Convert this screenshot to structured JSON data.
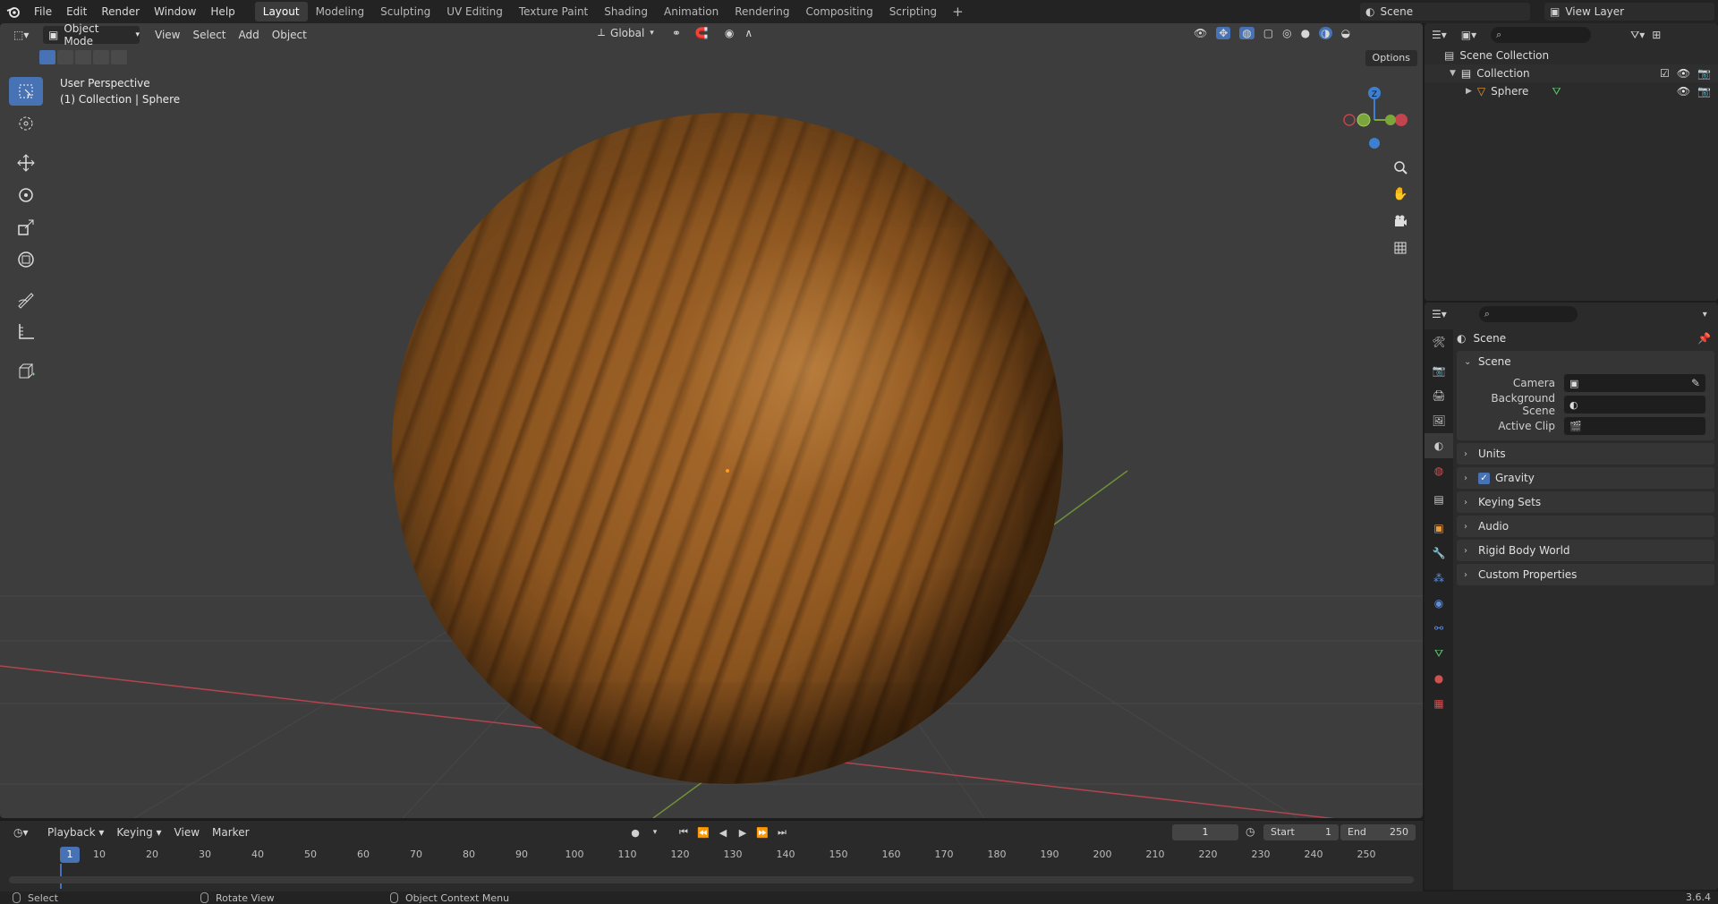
{
  "topbar": {
    "menus": [
      "File",
      "Edit",
      "Render",
      "Window",
      "Help"
    ],
    "workspaces": [
      "Layout",
      "Modeling",
      "Sculpting",
      "UV Editing",
      "Texture Paint",
      "Shading",
      "Animation",
      "Rendering",
      "Compositing",
      "Scripting"
    ],
    "active_workspace": "Layout",
    "add_label": "+",
    "scene": "Scene",
    "view_layer": "View Layer"
  },
  "viewport": {
    "mode": "Object Mode",
    "menus": [
      "View",
      "Select",
      "Add",
      "Object"
    ],
    "orientation": "Global",
    "options_label": "Options",
    "overlay_line1": "User Perspective",
    "overlay_line2": "(1) Collection | Sphere",
    "gizmo": {
      "z": "Z"
    },
    "tools": [
      "select-box-icon",
      "cursor-icon",
      "move-icon",
      "rotate-icon",
      "scale-icon",
      "transform-icon",
      "annotate-icon",
      "measure-icon",
      "add-cube-icon"
    ]
  },
  "timeline": {
    "menus": [
      "Playback",
      "Keying",
      "View",
      "Marker"
    ],
    "current_frame": "1",
    "start_label": "Start",
    "start_value": "1",
    "end_label": "End",
    "end_value": "250",
    "ticks": [
      "1",
      "10",
      "20",
      "30",
      "40",
      "50",
      "60",
      "70",
      "80",
      "90",
      "100",
      "110",
      "120",
      "130",
      "140",
      "150",
      "160",
      "170",
      "180",
      "190",
      "200",
      "210",
      "220",
      "230",
      "240",
      "250"
    ]
  },
  "statusbar": {
    "select": "Select",
    "rotate": "Rotate View",
    "context": "Object Context Menu",
    "version": "3.6.4"
  },
  "outliner": {
    "root": "Scene Collection",
    "collection": "Collection",
    "object": "Sphere"
  },
  "properties": {
    "title": "Scene",
    "scene_panel": "Scene",
    "camera_label": "Camera",
    "background_label": "Background Scene",
    "clip_label": "Active Clip",
    "panels": [
      "Units",
      "Gravity",
      "Keying Sets",
      "Audio",
      "Rigid Body World",
      "Custom Properties"
    ]
  },
  "colors": {
    "accent": "#4772b3",
    "viewport_bg": "#3d3d3d",
    "x_axis": "#c2444e",
    "y_axis": "#7aa63c",
    "z_axis": "#3f7fd1"
  }
}
